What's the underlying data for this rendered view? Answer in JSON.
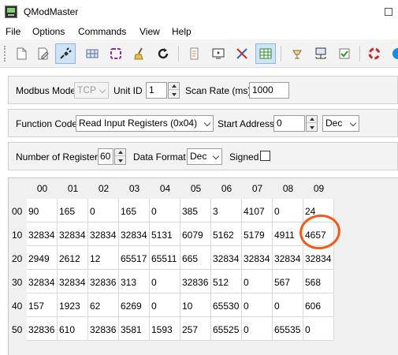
{
  "window": {
    "title": "QModMaster"
  },
  "menu": [
    "File",
    "Options",
    "Commands",
    "View",
    "Help"
  ],
  "toolbar": {
    "buttons": [
      {
        "icon": "new-session-icon"
      },
      {
        "icon": "edit-icon"
      },
      {
        "icon": "connect-plug-icon",
        "active": true
      },
      {
        "icon": "grid-dots-icon"
      },
      {
        "icon": "puzzle-icon"
      },
      {
        "icon": "broom-clear-icon"
      },
      {
        "icon": "refresh-icon"
      },
      {
        "icon": "log-document-icon"
      },
      {
        "icon": "monitor-icon"
      },
      {
        "icon": "tools-icon"
      },
      {
        "icon": "table-view-icon",
        "active": true
      },
      {
        "icon": "lamp-icon"
      },
      {
        "icon": "network-icon"
      },
      {
        "icon": "check-icon"
      },
      {
        "icon": "lifebuoy-icon"
      }
    ]
  },
  "modbus": {
    "mode_label": "Modbus Mode",
    "mode_value": "TCP",
    "unit_id_label": "Unit ID",
    "unit_id": "1",
    "scan_rate_label": "Scan Rate (ms)",
    "scan_rate": "1000"
  },
  "function": {
    "label": "Function Code",
    "value": "Read Input Registers (0x04)",
    "start_address_label": "Start Address",
    "start_address": "0",
    "address_format": "Dec"
  },
  "registers": {
    "count_label": "Number of Registers",
    "count": "60",
    "data_format_label": "Data Format",
    "data_format": "Dec",
    "signed_label": "Signed",
    "signed": false
  },
  "grid": {
    "columns": [
      "00",
      "01",
      "02",
      "03",
      "04",
      "05",
      "06",
      "07",
      "08",
      "09"
    ],
    "rows": [
      {
        "label": "00",
        "values": [
          "90",
          "165",
          "0",
          "165",
          "0",
          "385",
          "3",
          "4107",
          "0",
          "24"
        ]
      },
      {
        "label": "10",
        "values": [
          "32834",
          "32834",
          "32834",
          "32834",
          "5131",
          "6079",
          "5162",
          "5179",
          "4911",
          "4657"
        ]
      },
      {
        "label": "20",
        "values": [
          "2949",
          "2612",
          "12",
          "65517",
          "65511",
          "665",
          "32834",
          "32834",
          "32834",
          "32834"
        ]
      },
      {
        "label": "30",
        "values": [
          "32834",
          "32834",
          "32836",
          "313",
          "0",
          "32836",
          "512",
          "0",
          "567",
          "568"
        ]
      },
      {
        "label": "40",
        "values": [
          "157",
          "1923",
          "62",
          "6269",
          "0",
          "10",
          "65530",
          "0",
          "0",
          "606"
        ]
      },
      {
        "label": "50",
        "values": [
          "32836",
          "610",
          "32836",
          "3581",
          "1593",
          "257",
          "65525",
          "0",
          "65535",
          "0"
        ]
      }
    ]
  },
  "colors": {
    "annotation_circle": "#f05a1a",
    "active_button": "#cde3f7"
  }
}
